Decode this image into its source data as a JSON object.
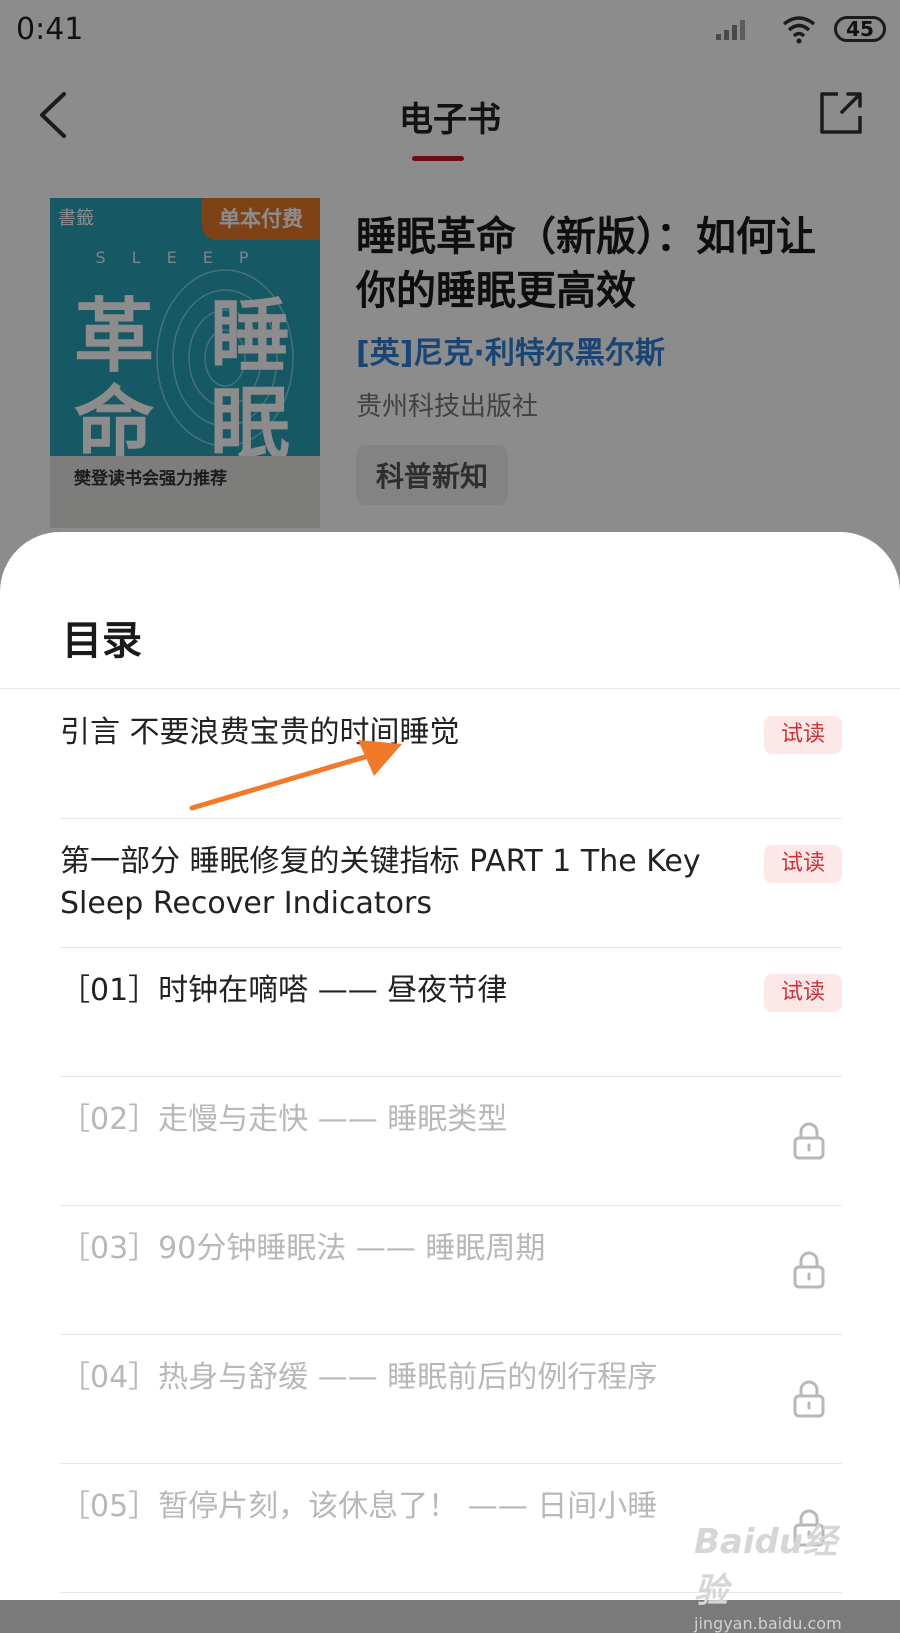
{
  "status_bar": {
    "time": "0:41",
    "battery": "45"
  },
  "header": {
    "title": "电子书"
  },
  "book": {
    "cover": {
      "pay_badge": "单本付费",
      "brand": "書籤",
      "sleep_word": "SLEEP",
      "chars": [
        "革",
        "命",
        "睡",
        "眠"
      ],
      "band_text": "樊登读书会强力推荐"
    },
    "title": "睡眠革命（新版）：如何让你的睡眠更高效",
    "author": "[英]尼克·利特尔黑尔斯",
    "publisher": "贵州科技出版社",
    "tag": "科普新知"
  },
  "toc": {
    "title": "目录",
    "trial_label": "试读",
    "items": [
      {
        "text": "引言 不要浪费宝贵的时间睡觉",
        "locked": false
      },
      {
        "text": "第一部分 睡眠修复的关键指标 PART 1 The Key Sleep Recover Indicators",
        "locked": false
      },
      {
        "text": "［01］时钟在嘀嗒 —— 昼夜节律",
        "locked": false
      },
      {
        "text": "［02］走慢与走快 —— 睡眠类型",
        "locked": true
      },
      {
        "text": "［03］90分钟睡眠法 —— 睡眠周期",
        "locked": true
      },
      {
        "text": "［04］热身与舒缓 —— 睡眠前后的例行程序",
        "locked": true
      },
      {
        "text": "［05］暂停片刻，该休息了！ —— 日间小睡",
        "locked": true
      }
    ]
  },
  "watermark": {
    "top": "Baidu经验",
    "bottom": "jingyan.baidu.com"
  },
  "colors": {
    "accent": "#c8161d",
    "author": "#2d7fd6",
    "trial_bg": "#fde8e8",
    "trial_text": "#d0303a",
    "arrow": "#f07a2a"
  }
}
